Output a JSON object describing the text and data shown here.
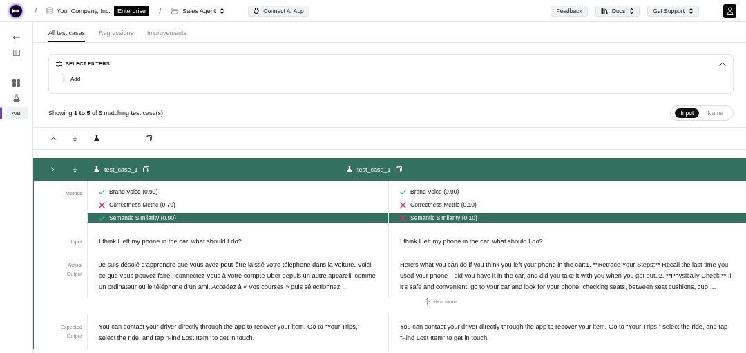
{
  "topbar": {
    "separators": [
      "/",
      "/"
    ],
    "organization": "Your Company, Inc.",
    "plan_badge": "Enterprise",
    "project": "Sales Agent",
    "connect_button": "Connect AI App",
    "buttons": [
      {
        "kind": "plain",
        "label": "Feedback"
      },
      {
        "kind": "docs",
        "label": "Docs"
      },
      {
        "kind": "menu",
        "label": "Get Support"
      }
    ]
  },
  "sidebar": {
    "items": [
      {
        "kind": "back",
        "selected": false
      },
      {
        "kind": "panel",
        "selected": false
      },
      {
        "kind": "grid",
        "selected": false
      },
      {
        "kind": "flask",
        "selected": false
      },
      {
        "kind": "text",
        "label": "A/B",
        "selected": true
      }
    ]
  },
  "tabs": [
    {
      "label": "All test cases",
      "selected": true
    },
    {
      "label": "Regressions",
      "selected": false
    },
    {
      "label": "Improvements",
      "selected": false
    }
  ],
  "filters": {
    "title": "SELECT FILTERS",
    "expanded": true,
    "add_button": "Add"
  },
  "summary": "Showing **1 to 5** of 5 matching test case(s)",
  "view_toggle": [
    {
      "label": "Input",
      "selected": true
    },
    {
      "label": "Name",
      "selected": false
    }
  ],
  "test_case": {
    "expanded": false,
    "columns": [
      "test_case_1",
      "test_case_1"
    ],
    "metrics_label": "Metrics",
    "metrics": [
      {
        "highlighted": false,
        "results": [
          {
            "text": "Brand Voice (0.90)",
            "passed": true
          },
          {
            "text": "Brand Voice (0.90)",
            "passed": true
          }
        ]
      },
      {
        "highlighted": false,
        "results": [
          {
            "text": "Correctness Metric (0.70)",
            "passed": false
          },
          {
            "text": "Correctness Metric (0.10)",
            "passed": false
          }
        ]
      },
      {
        "highlighted": true,
        "results": [
          {
            "text": "Semantic Similarity (0.90)",
            "passed": true
          },
          {
            "text": "Semantic Similarity (0.10)",
            "passed": false
          }
        ]
      }
    ],
    "fields": [
      {
        "label": "Input",
        "values": [
          "I think I left my phone in the car, what should I do?",
          "I think I left my phone in the car, what should I do?"
        ]
      },
      {
        "label": "Actual Output",
        "values": [
          "Je suis désolé d’apprendre que vous avez peut-être laissé votre téléphone dans la voiture. Voici ce que vous pouvez faire : connectez-vous à votre compte Uber depuis un autre appareil, comme un ordinateur ou le téléphone d’un ami. Accédez à « Vos courses » puis sélectionnez …",
          "Here’s what you can do if you think you left your phone in the car:1. **Retrace Your Steps:** Recall the last time you used your phone—did you have it in the car, and did you take it with you when you got out?2. **Physically Check:** If it’s safe and convenient, go to your car and look for your phone, checking seats, between seat cushions, cup …"
        ],
        "more_link": "view more"
      },
      {
        "label": "Expected Output",
        "values": [
          "You can contact your driver directly through the app to recover your item. Go to “Your Trips,” select the ride, and tap “Find Lost Item” to get in touch.",
          "You can contact your driver directly through the app to recover your item. Go to “Your Trips,” select the ride, and tap “Find Lost Item” to get in touch."
        ]
      }
    ]
  }
}
